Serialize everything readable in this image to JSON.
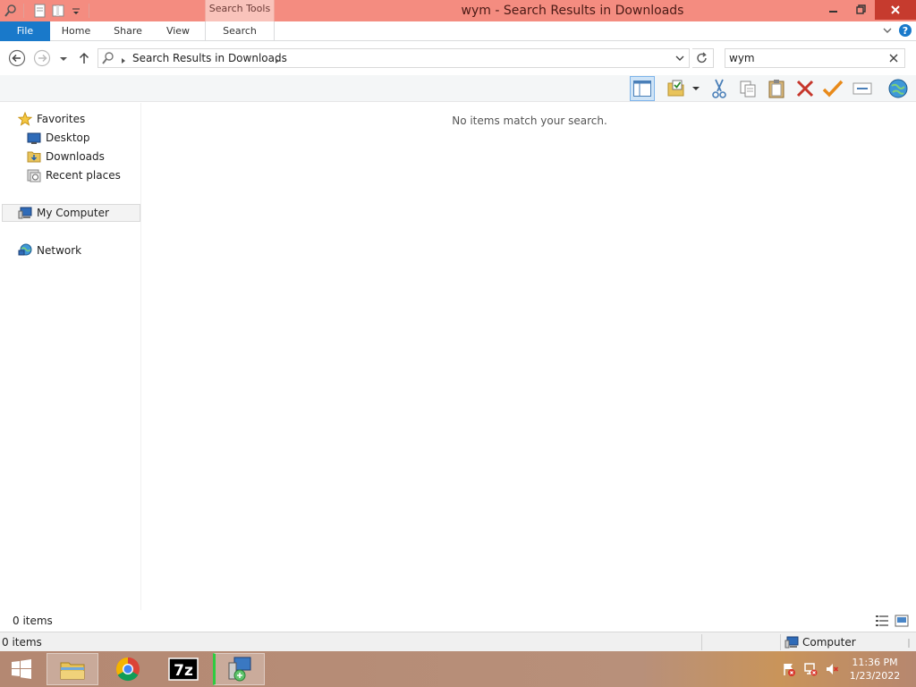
{
  "window": {
    "title": "wym - Search Results in Downloads",
    "contextual_tab_group": "Search Tools"
  },
  "ribbon": {
    "tabs": [
      "File",
      "Home",
      "Share",
      "View",
      "Search"
    ]
  },
  "address": {
    "path": "Search Results in Downloads"
  },
  "search": {
    "value": "wym"
  },
  "navigation": {
    "favorites": "Favorites",
    "favorites_items": [
      "Desktop",
      "Downloads",
      "Recent places"
    ],
    "computer": "My Computer",
    "network": "Network"
  },
  "content": {
    "empty_message": "No items match your search."
  },
  "status": {
    "item_count": "0 items",
    "bottom_item_count": "0 items",
    "location": "Computer"
  },
  "taskbar": {
    "time": "11:36 PM",
    "date": "1/23/2022"
  },
  "colors": {
    "titlebar": "#f48c80",
    "file_tab": "#1979ca",
    "close_button": "#c63b2e"
  }
}
